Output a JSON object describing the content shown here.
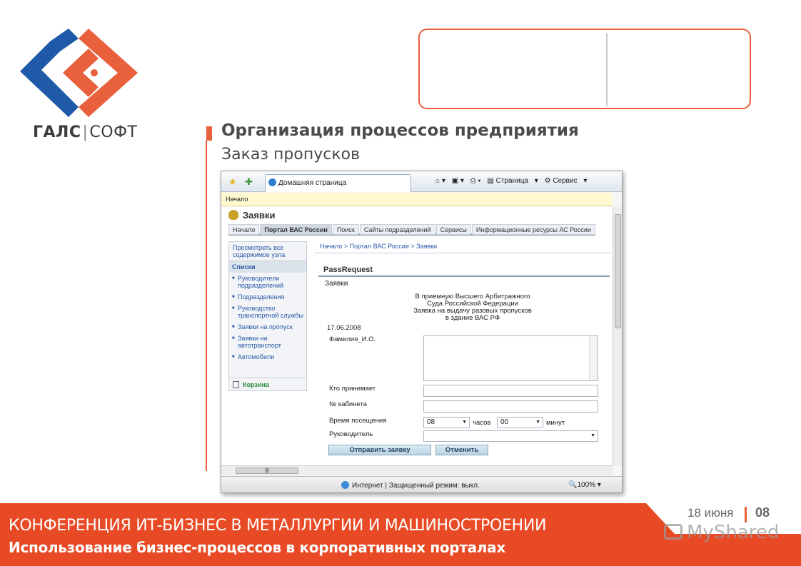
{
  "brand": {
    "name_bold": "ГАЛС",
    "name_light": "СОФТ"
  },
  "slide": {
    "title": "Организация процессов предприятия",
    "subtitle": "Заказ пропусков"
  },
  "browser": {
    "tab_title": "Домашняя страница",
    "toolbar": {
      "page_label": "Страница",
      "service_label": "Сервис"
    },
    "info_bar": "Начало",
    "status": {
      "zone": "Интернет | Защищенный режим: выкл.",
      "zoom": "100%"
    }
  },
  "site": {
    "title": "Заявки",
    "top_nav": [
      {
        "label": "Начало",
        "active": false
      },
      {
        "label": "Портал ВАС России",
        "active": true
      },
      {
        "label": "Поиск",
        "active": false
      },
      {
        "label": "Сайты подразделений",
        "active": false
      },
      {
        "label": "Сервисы",
        "active": false
      },
      {
        "label": "Информационные ресурсы АС России",
        "active": false
      }
    ],
    "left_nav": {
      "view_all": "Просмотреть все содержимое узла",
      "lists_header": "Списки",
      "items": [
        "Руководители подразделений",
        "Подразделения",
        "Руководство транспортной службы",
        "Заявки на пропуск",
        "Заявки на автотранспорт",
        "Автомобили"
      ],
      "trash": "Корзина"
    },
    "breadcrumb": "Начало > Портал ВАС России > Заявки"
  },
  "form": {
    "title": "PassRequest",
    "list_name": "Заявки",
    "letter": [
      "В приемную Высшего Арбитражного",
      "Суда Российской Федерации",
      "Заявка на выдачу разовых пропусков",
      "в здание ВАС РФ"
    ],
    "date": "17.06.2008",
    "fio_label": "Фамилия_И.О.",
    "receiver_label": "Кто принимает",
    "room_label": "№ кабинета",
    "time_label": "Время посещения",
    "hours_value": "08",
    "hours_unit": "часов",
    "minutes_value": "00",
    "minutes_unit": "минут",
    "manager_label": "Руководитель",
    "submit_label": "Отправить заявку",
    "cancel_label": "Отменить"
  },
  "footer": {
    "conference": "КОНФЕРЕНЦИЯ ИТ-БИЗНЕС В МЕТАЛЛУРГИИ И МАШИНОСТРОЕНИИ",
    "subtitle": "Использование бизнес-процессов в корпоративных порталах",
    "date": "18 июня",
    "page": "08",
    "watermark": "MyShared"
  },
  "colors": {
    "accent": "#e8603c",
    "logo_blue": "#1f5aa8",
    "link": "#2a5aa8"
  }
}
